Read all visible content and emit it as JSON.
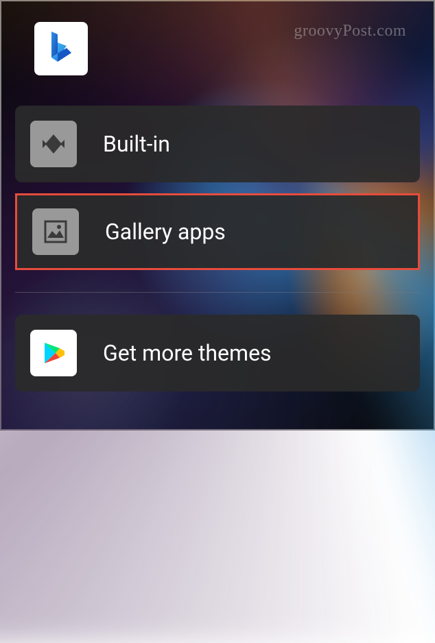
{
  "watermark": "groovyPost.com",
  "menu": {
    "items": [
      {
        "label": "Built-in",
        "icon": "builtin-icon",
        "highlighted": false
      },
      {
        "label": "Gallery apps",
        "icon": "gallery-icon",
        "highlighted": true
      },
      {
        "label": "Get more themes",
        "icon": "playstore-icon",
        "highlighted": false
      }
    ]
  }
}
